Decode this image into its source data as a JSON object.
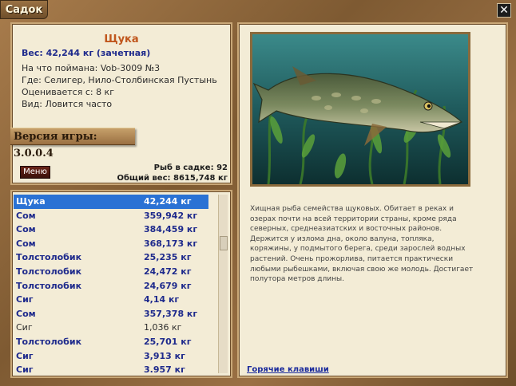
{
  "window": {
    "title": "Садок"
  },
  "fish": {
    "name": "Щука",
    "weight_line": "Вес: 42,244 кг (зачетная)",
    "info_lines": [
      "На что поймана: Vob-3009 №3",
      "Где: Селигер, Нило-Столбинская Пустынь",
      "Оценивается с: 8 кг",
      "Вид: Ловится часто"
    ]
  },
  "version": "Версия игры: 3.0.0.4",
  "menu_button": "Меню",
  "stats": {
    "count_line": "Рыб в садке: 92",
    "total_line": "Общий вес: 8615,748 кг"
  },
  "catch_list": [
    {
      "name": "Щука",
      "weight": "42,244 кг",
      "selected": true
    },
    {
      "name": "Сом",
      "weight": "359,942 кг"
    },
    {
      "name": "Сом",
      "weight": "384,459 кг"
    },
    {
      "name": "Сом",
      "weight": "368,173 кг"
    },
    {
      "name": "Толстолобик",
      "weight": "25,235 кг"
    },
    {
      "name": "Толстолобик",
      "weight": "24,472 кг"
    },
    {
      "name": "Толстолобик",
      "weight": "24,679 кг"
    },
    {
      "name": "Сиг",
      "weight": "4,14 кг"
    },
    {
      "name": "Сом",
      "weight": "357,378 кг"
    },
    {
      "name": "Сиг",
      "weight": "1,036 кг",
      "plain": true
    },
    {
      "name": "Толстолобик",
      "weight": "25,701 кг"
    },
    {
      "name": "Сиг",
      "weight": "3,913 кг"
    },
    {
      "name": "Сиг",
      "weight": "3.957 кг"
    }
  ],
  "description": "Хищная рыба семейства щуковых. Обитает в реках и озерах почти на всей территории страны, кроме ряда северных, среднеазиатских и восточных районов. Держится у излома дна, около валуна, топляка, коряжины, у подмытого берега, среди зарослей водных растений. Очень прожорлива, питается практически любыми рыбешками, включая свою же молодь. Достигает полутора метров длины.",
  "hotkeys_link": "Горячие клавиши",
  "icons": {
    "close": "close-icon"
  },
  "colors": {
    "title_orange": "#c0561c",
    "list_blue": "#1e2a8c",
    "selection": "#2a72d4"
  }
}
